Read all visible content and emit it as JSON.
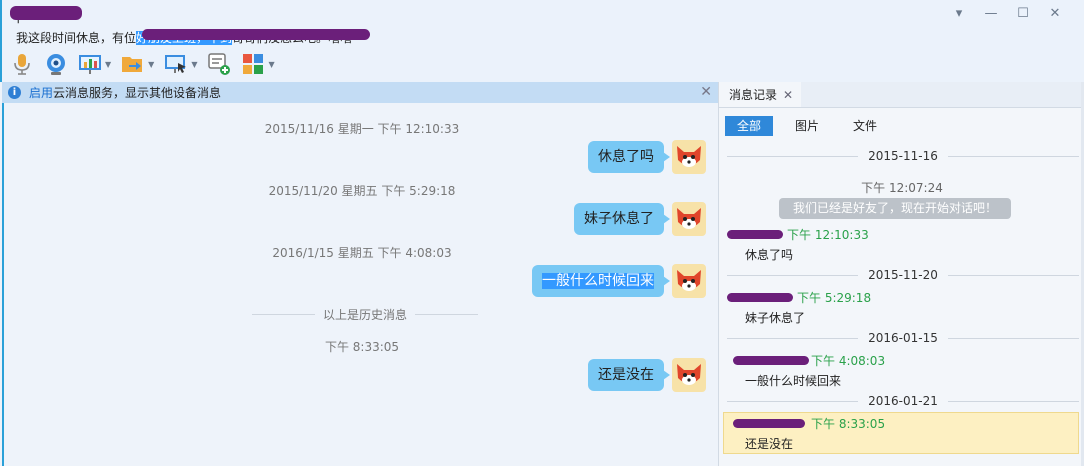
{
  "header": {
    "contact_name": "下",
    "status_prefix": "我这段时间休息，有位",
    "status_selected": "好朋友上班，干到",
    "status_suffix": "哥哥们没怎么吧。嘻嘻"
  },
  "window_controls": {
    "menu": "▾",
    "minimize": "—",
    "maximize": "☐",
    "close": "✕"
  },
  "toolbar": {
    "items": [
      {
        "icon": "microphone-icon"
      },
      {
        "icon": "video-call-icon"
      },
      {
        "icon": "presentation-icon",
        "dropdown": true
      },
      {
        "icon": "send-file-icon",
        "dropdown": true
      },
      {
        "icon": "remote-desktop-icon",
        "dropdown": true
      },
      {
        "icon": "create-discussion-icon"
      },
      {
        "icon": "app-grid-icon",
        "dropdown": true
      }
    ]
  },
  "notice": {
    "link": "启用",
    "text": "云消息服务，显示其他设备消息",
    "close": "✕"
  },
  "chat": {
    "timestamps": [
      "2015/11/16 星期一 下午 12:10:33",
      "2015/11/20 星期五 下午 5:29:18",
      "2016/1/15 星期五 下午 4:08:03"
    ],
    "history_label": "以上是历史消息",
    "latest_time": "下午 8:33:05",
    "messages": [
      "休息了吗",
      "妹子休息了",
      "一般什么时候回来",
      "还是没在"
    ]
  },
  "history_panel": {
    "tab_title": "消息记录",
    "tab_close": "✕",
    "filters": [
      "全部",
      "图片",
      "文件"
    ],
    "active_filter": "全部",
    "system_time": "下午 12:07:24",
    "system_message": "我们已经是好友了，现在开始对话吧！",
    "entries": [
      {
        "date": "2015-11-16",
        "time": "下午 12:10:33",
        "text": "休息了吗"
      },
      {
        "date": "2015-11-20",
        "time": "下午 5:29:18",
        "text": "妹子休息了"
      },
      {
        "date": "2016-01-15",
        "time": "下午 4:08:03",
        "text": "一般什么时候回来"
      },
      {
        "date": "2016-01-21",
        "time": "下午 8:33:05",
        "text": "还是没在"
      }
    ]
  },
  "colors": {
    "accent_blue": "#2f88d9",
    "bubble_blue": "#78c8f4",
    "sender_green": "#2aa14a",
    "highlight_yellow": "#fdf0c2",
    "redaction_purple": "#6b1f7a"
  }
}
